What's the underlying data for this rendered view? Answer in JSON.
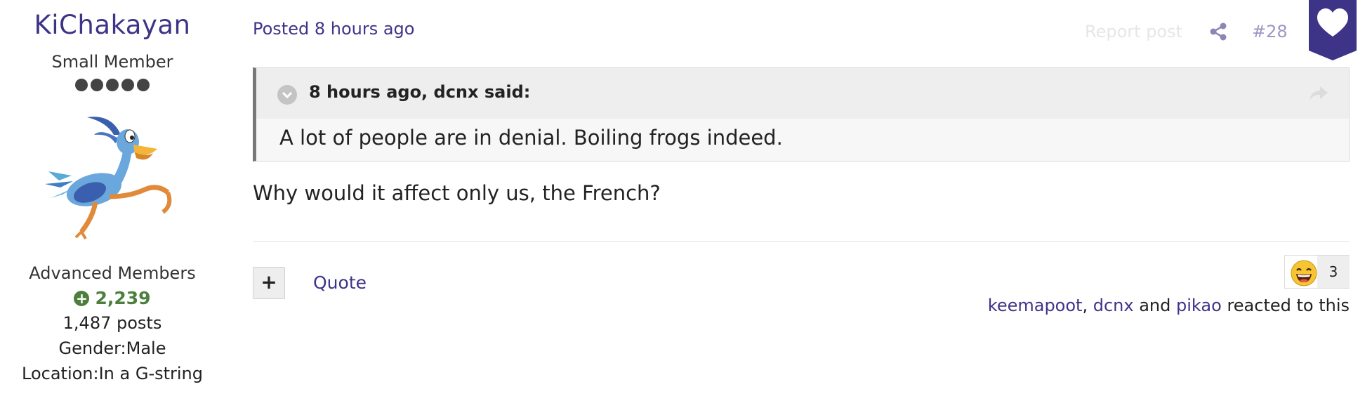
{
  "author": {
    "name": "KiChakayan",
    "title": "Small Member",
    "rank_dots": 5,
    "group": "Advanced Members",
    "reputation": "2,239",
    "posts": "1,487 posts",
    "gender": "Gender:Male",
    "location": "Location:In a G-string",
    "avatar_icon": "roadrunner-avatar"
  },
  "post": {
    "posted": "Posted 8 hours ago",
    "report": "Report post",
    "number": "#28",
    "body": "Why would it affect only us, the French?"
  },
  "quote": {
    "citation": "8 hours ago, dcnx said:",
    "text": "A lot of people are in denial. Boiling frogs indeed."
  },
  "footer": {
    "plus": "+",
    "quote_label": "Quote",
    "reaction_count": "3",
    "reactors": [
      "keemapoot",
      "dcnx",
      "pikao"
    ],
    "separator": ",",
    "and": "and",
    "reacted_suffix": "reacted to this"
  },
  "colors": {
    "link": "#3e3487",
    "reputation": "#4c7f3c",
    "like_badge": "#3e3487"
  }
}
